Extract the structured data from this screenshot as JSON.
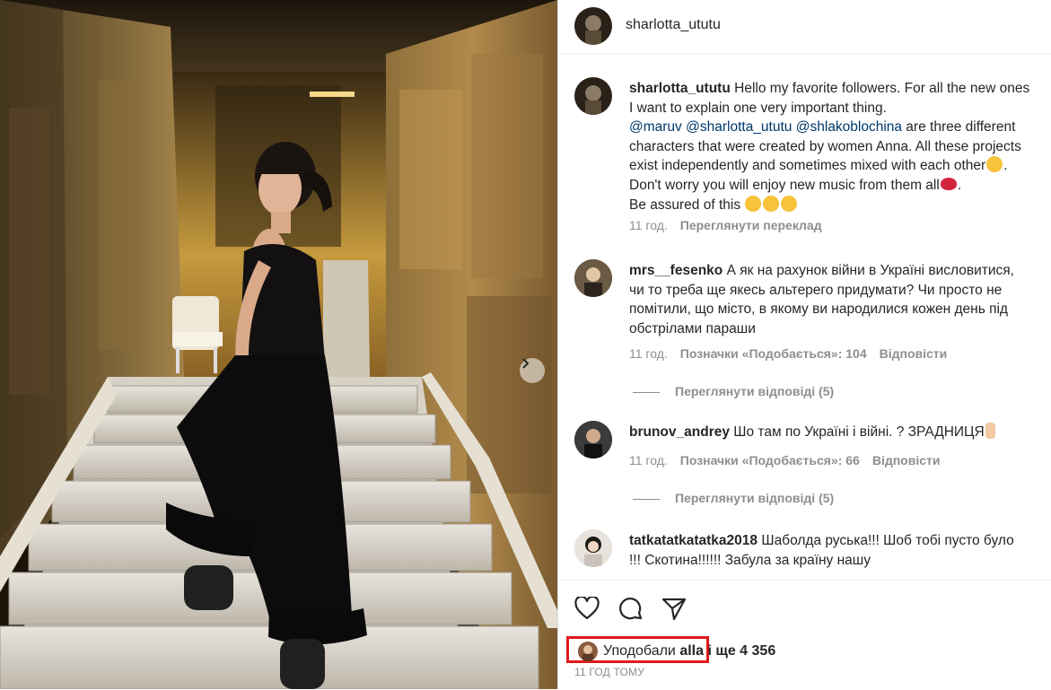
{
  "post": {
    "author": "sharlotta_ututu",
    "caption": {
      "user": "sharlotta_ututu",
      "text_1": "Hello my favorite followers. For all the new ones\nI want to explain one very important thing.\n",
      "mention_1": "@maruv",
      "mention_2": "@sharlotta_ututu",
      "mention_3": "@shlakoblochina",
      "text_2": " are three different\ncharacters that were created by women Anna. All these projects\nexist independently and sometimes mixed with each other",
      "text_3": ".\nDon't worry you will enjoy new music from them all",
      "text_4": ".\nBe assured of this ",
      "time": "11 год.",
      "translate": "Переглянути переклад"
    }
  },
  "comments": [
    {
      "user": "mrs__fesenko",
      "text": "А як на рахунок війни в Україні висловитися,\nчи то треба ще якесь альтерего придумати? Чи просто не\nпомітили, що місто, в якому ви народилися кожен день під\nобстрілами параши",
      "time": "11 год.",
      "likes": "Позначки «Подобається»: 104",
      "reply": "Відповісти",
      "view_replies": "Переглянути відповіді (5)"
    },
    {
      "user": "brunov_andrey",
      "text": "Шо там по Україні і війні. ? ЗРАДНИЦЯ",
      "time": "11 год.",
      "likes": "Позначки «Подобається»: 66",
      "reply": "Відповісти",
      "view_replies": "Переглянути відповіді (5)"
    },
    {
      "user": "tatkatatkatatka2018",
      "text": "Шаболда руська!!! Шоб тобі пусто було\n!!! Скотина!!!!!! Забула за країну нашу"
    }
  ],
  "footer": {
    "liked_by_prefix": "Уподобали ",
    "liked_by_user": "alla",
    "liked_by_suffix": " і ще 4 356",
    "time_ago": "11 ГОД ТОМУ"
  },
  "icons": {
    "like": "heart-icon",
    "comment": "comment-icon",
    "share": "share-icon",
    "next": "chevron-right-icon"
  },
  "colors": {
    "mention": "#00376b",
    "meta": "#8e8e8e",
    "highlight_box": "#e0181b"
  }
}
